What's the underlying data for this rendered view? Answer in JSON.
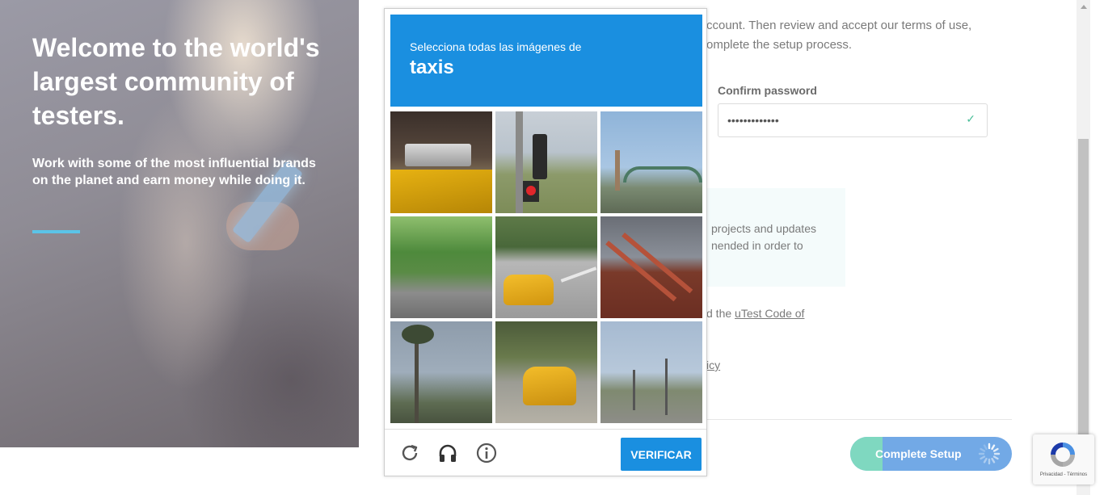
{
  "hero": {
    "title": "Welcome to the world's largest community of testers.",
    "subtitle": "Work with some of the most influential brands on the planet and earn money while doing it."
  },
  "form": {
    "intro_line1": "ccount. Then review and accept our terms of use,",
    "intro_line2": "omplete the setup process.",
    "confirm_password_label": "Confirm password",
    "confirm_password_value": "•••••••••••••",
    "info_line1": "projects and updates",
    "info_line2": "nended in order to",
    "code_prefix": "d the ",
    "code_link": "uTest Code of",
    "policy_fragment": "icy",
    "complete_button": "Complete Setup",
    "complete_progress": 0.2
  },
  "captcha": {
    "instruction": "Selecciona todas las imágenes de",
    "target": "taxis",
    "verify_button": "VERIFICAR",
    "icons": [
      "reload-icon",
      "audio-icon",
      "info-icon"
    ],
    "accent_color": "#1a8fe0"
  },
  "recaptcha_badge": {
    "terms": "Privacidad - Términos"
  }
}
